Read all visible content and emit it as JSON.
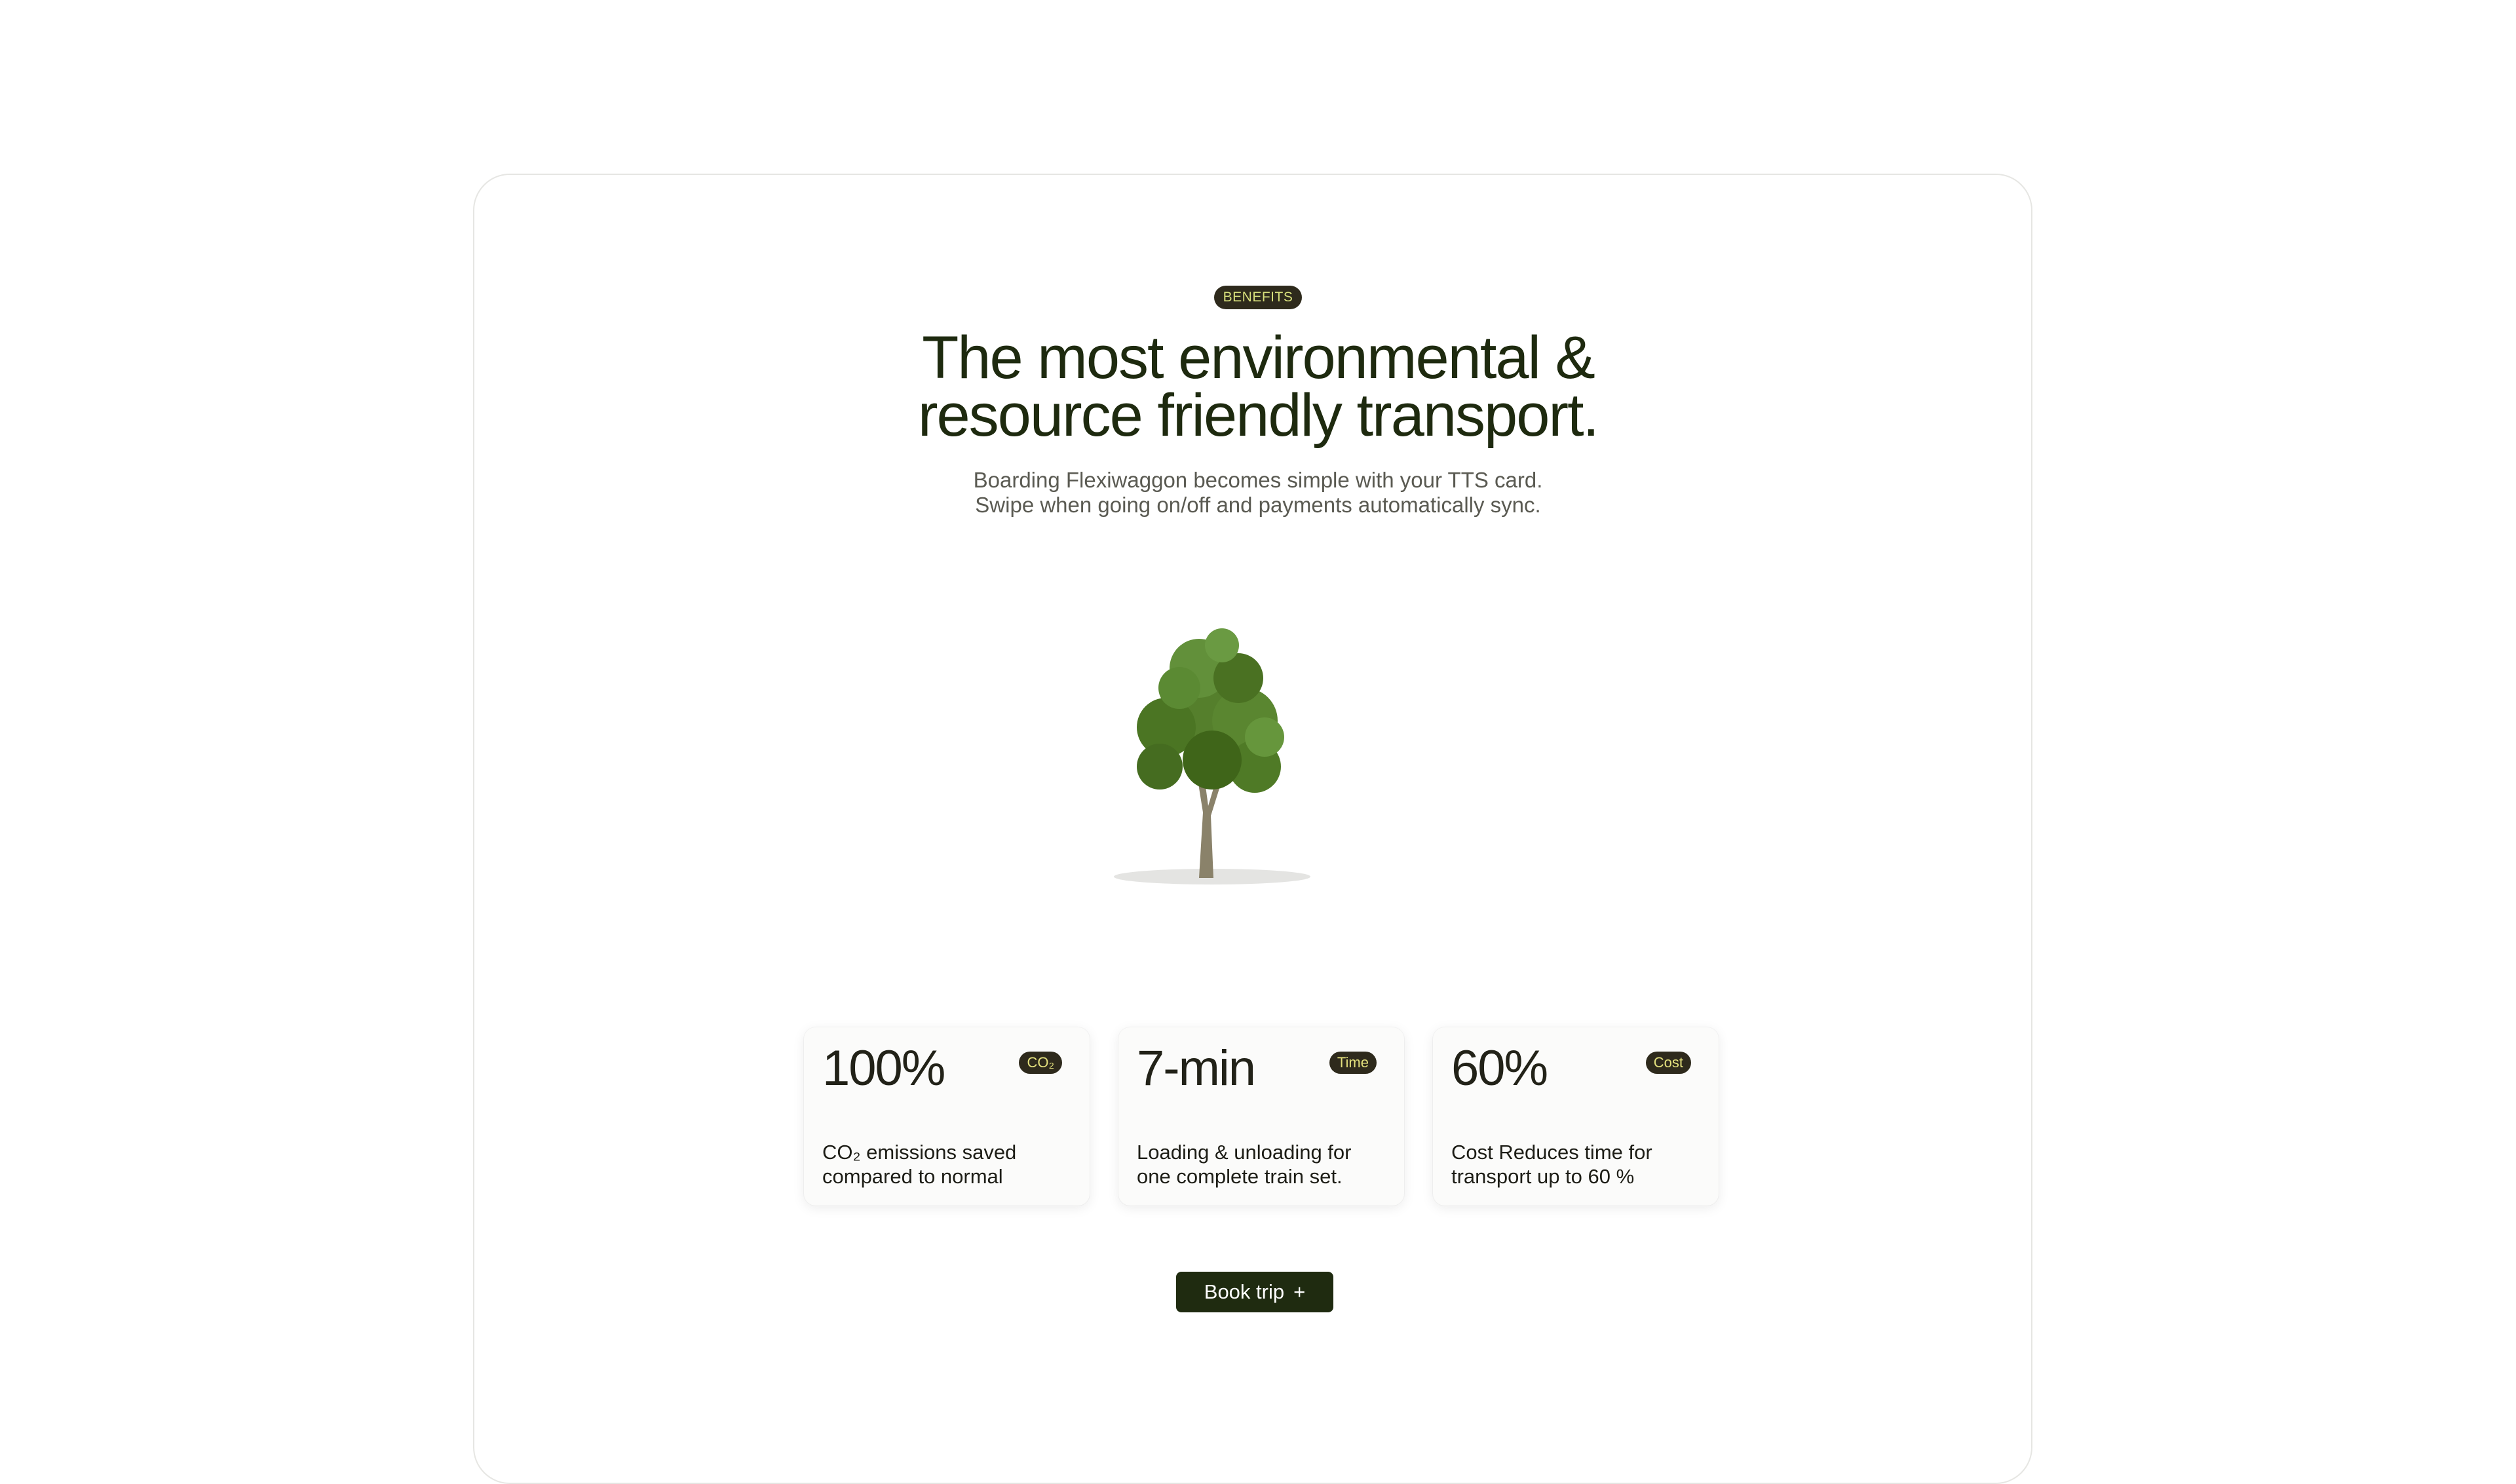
{
  "section": {
    "badge": "BENEFITS",
    "headline": [
      "The most environmental &",
      "resource friendly transport."
    ],
    "subtitle": [
      "Boarding Flexiwaggon becomes simple with your TTS card.",
      "Swipe when going on/off and payments automatically sync."
    ]
  },
  "image": {
    "icon": "tree-illustration"
  },
  "stats": [
    {
      "value": "100%",
      "tag": "CO₂",
      "desc": [
        "CO₂ emissions saved",
        "compared to normal"
      ]
    },
    {
      "value": "7-min",
      "tag": "Time",
      "desc": [
        "Loading & unloading for",
        "one complete train set."
      ]
    },
    {
      "value": "60%",
      "tag": "Cost",
      "desc": [
        "Cost Reduces time for",
        "transport up to 60 %"
      ]
    }
  ],
  "cta": {
    "label": "Book trip",
    "icon": "plus-icon",
    "glyph": "+"
  },
  "colors": {
    "dark_green": "#1f2b10",
    "badge_bg": "#2e2a1c",
    "badge_text": "#d7df7c",
    "tree_green": "#4f7a26"
  }
}
